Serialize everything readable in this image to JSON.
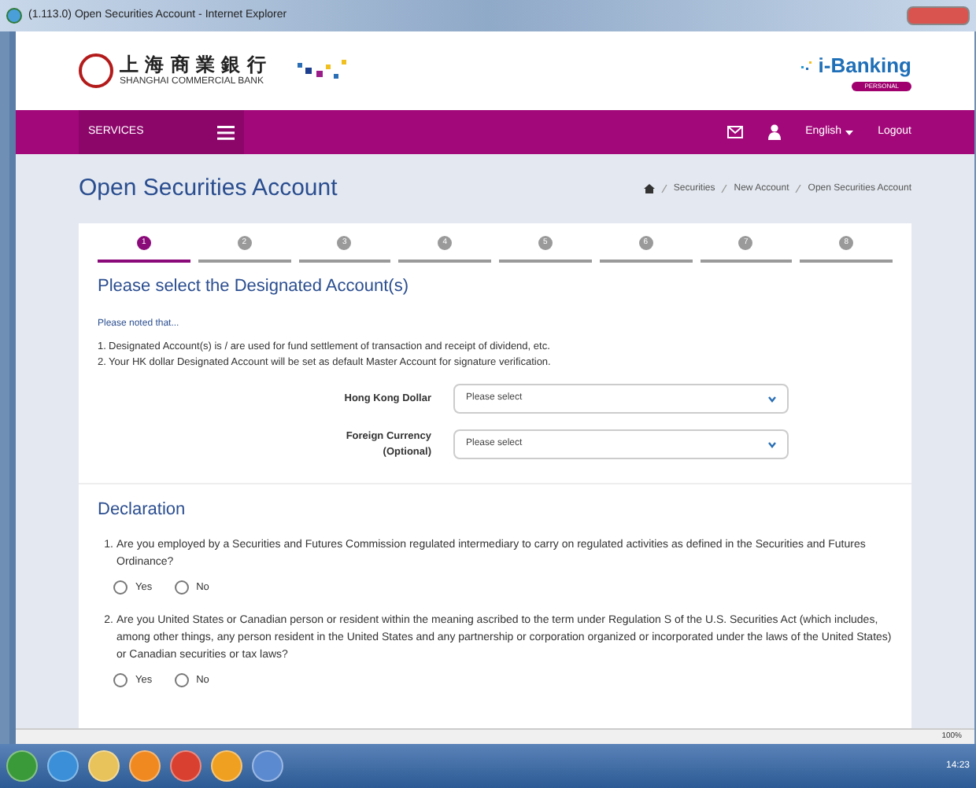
{
  "window": {
    "title": "(1.113.0) Open Securities Account - Internet Explorer"
  },
  "header": {
    "bank_name_zh": "上 海 商 業 銀 行",
    "bank_name_en": "SHANGHAI COMMERCIAL BANK",
    "brand": "i-Banking",
    "brand_badge": "PERSONAL"
  },
  "nav": {
    "services": "SERVICES",
    "language": "English",
    "logout": "Logout"
  },
  "page": {
    "title": "Open Securities Account",
    "breadcrumb": [
      "Securities",
      "New Account",
      "Open Securities Account"
    ]
  },
  "steps": [
    {
      "label": "1",
      "selected": true
    },
    {
      "label": "2",
      "selected": false
    },
    {
      "label": "3",
      "selected": false
    },
    {
      "label": "4",
      "selected": false
    },
    {
      "label": "5",
      "selected": false
    },
    {
      "label": "6",
      "selected": false
    },
    {
      "label": "7",
      "selected": false
    },
    {
      "label": "8",
      "selected": false
    }
  ],
  "designated": {
    "heading": "Please select the Designated Account(s)",
    "note": "Please noted that...",
    "notes": [
      {
        "number": "1.",
        "text": "Designated Account(s) is / are used for fund settlement of transaction and receipt of dividend, etc."
      },
      {
        "number": "2.",
        "text": "Your HK dollar Designated Account will be set as default Master Account for signature verification."
      }
    ],
    "fields": [
      {
        "label": "Hong Kong Dollar",
        "placeholder": "Please select"
      },
      {
        "label": "Foreign Currency",
        "sublabel": "(Optional)",
        "placeholder": "Please select"
      }
    ]
  },
  "declaration": {
    "heading": "Declaration",
    "questions": [
      {
        "number": "1.",
        "text": "Are you employed by a Securities and Futures Commission regulated intermediary to carry on regulated activities as defined in the Securities and Futures Ordinance?",
        "options": [
          {
            "label": "Yes",
            "selected": false
          },
          {
            "label": "No",
            "selected": false
          }
        ]
      },
      {
        "number": "2.",
        "text": "Are you United States or Canadian person or resident within the meaning ascribed to the term under Regulation S of the U.S. Securities Act (which includes, among other things, any person resident in the United States and any partnership or corporation organized or incorporated under the laws of the United States) or Canadian securities or tax laws?",
        "options": [
          {
            "label": "Yes",
            "selected": false
          },
          {
            "label": "No",
            "selected": false
          }
        ]
      }
    ]
  },
  "status_bar": {
    "zoom": "100%"
  },
  "taskbar": {
    "time": "14:23"
  }
}
